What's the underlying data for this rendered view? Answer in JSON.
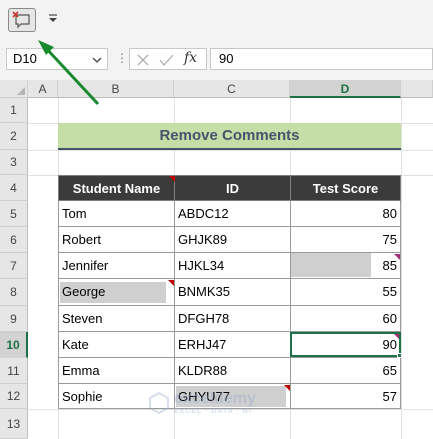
{
  "name_box": {
    "value": "D10"
  },
  "formula_bar": {
    "value": "90",
    "fx_label": "fx"
  },
  "columns": [
    "A",
    "B",
    "C",
    "D"
  ],
  "rows": [
    "1",
    "2",
    "3",
    "4",
    "5",
    "6",
    "7",
    "8",
    "9",
    "10",
    "11",
    "12",
    "13"
  ],
  "active_cell": {
    "column": "D",
    "row": "10"
  },
  "title": "Remove Comments",
  "table": {
    "headers": [
      "Student Name",
      "ID",
      "Test Score"
    ],
    "rows": [
      {
        "name": "Tom",
        "id": "ABDC12",
        "score": "80"
      },
      {
        "name": "Robert",
        "id": "GHJK89",
        "score": "75"
      },
      {
        "name": "Jennifer",
        "id": "HJKL34",
        "score": "85"
      },
      {
        "name": "George",
        "id": "BNMK35",
        "score": "55"
      },
      {
        "name": "Steven",
        "id": "DFGH78",
        "score": "60"
      },
      {
        "name": "Kate",
        "id": "ERHJ47",
        "score": "90"
      },
      {
        "name": "Emma",
        "id": "KLDR88",
        "score": "65"
      },
      {
        "name": "Sophie",
        "id": "GHYU77",
        "score": "57"
      }
    ]
  },
  "watermark": {
    "name": "exceldemy",
    "tagline": "EXCEL · DATA · BI"
  },
  "colors": {
    "title_fill": "#c5dea8",
    "title_text": "#44546a",
    "header_fill": "#3b3b3b",
    "comment_fill": "#cfcfcf",
    "comment_indicator": "#c00000",
    "accent": "#1e7145",
    "arrow": "#1a8a2e"
  },
  "icons": [
    "delete-comment-icon",
    "customize-qat-icon",
    "dropdown-arrow-icon",
    "cancel-icon",
    "enter-icon",
    "insert-function-icon"
  ]
}
